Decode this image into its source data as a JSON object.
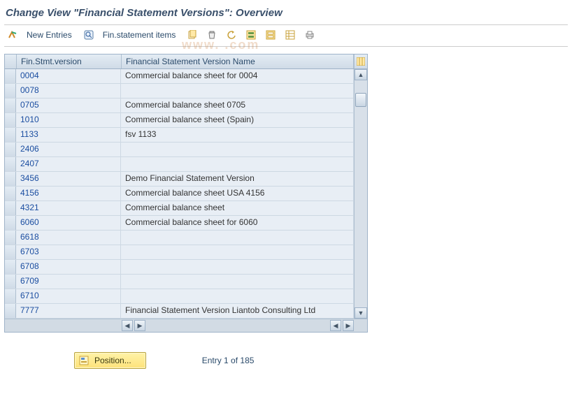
{
  "title": "Change View \"Financial Statement Versions\": Overview",
  "watermark": "www.               .com",
  "toolbar": {
    "new_entries": "New Entries",
    "fin_items": "Fin.statement items"
  },
  "table": {
    "header": {
      "version": "Fin.Stmt.version",
      "name": "Financial Statement Version Name"
    },
    "rows": [
      {
        "version": "0004",
        "name": "Commercial balance sheet for 0004"
      },
      {
        "version": "0078",
        "name": ""
      },
      {
        "version": "0705",
        "name": "Commercial balance sheet 0705"
      },
      {
        "version": "1010",
        "name": "Commercial balance sheet (Spain)"
      },
      {
        "version": "1133",
        "name": "fsv 1133"
      },
      {
        "version": "2406",
        "name": ""
      },
      {
        "version": "2407",
        "name": ""
      },
      {
        "version": "3456",
        "name": "Demo Financial Statement Version"
      },
      {
        "version": "4156",
        "name": "Commercial balance sheet USA 4156"
      },
      {
        "version": "4321",
        "name": "Commercial balance sheet"
      },
      {
        "version": "6060",
        "name": "Commercial balance sheet for 6060"
      },
      {
        "version": "6618",
        "name": ""
      },
      {
        "version": "6703",
        "name": ""
      },
      {
        "version": "6708",
        "name": ""
      },
      {
        "version": "6709",
        "name": ""
      },
      {
        "version": "6710",
        "name": ""
      },
      {
        "version": "7777",
        "name": "Financial Statement Version Liantob Consulting Ltd"
      }
    ]
  },
  "footer": {
    "position_label": "Position...",
    "entry_text": "Entry 1 of 185"
  }
}
